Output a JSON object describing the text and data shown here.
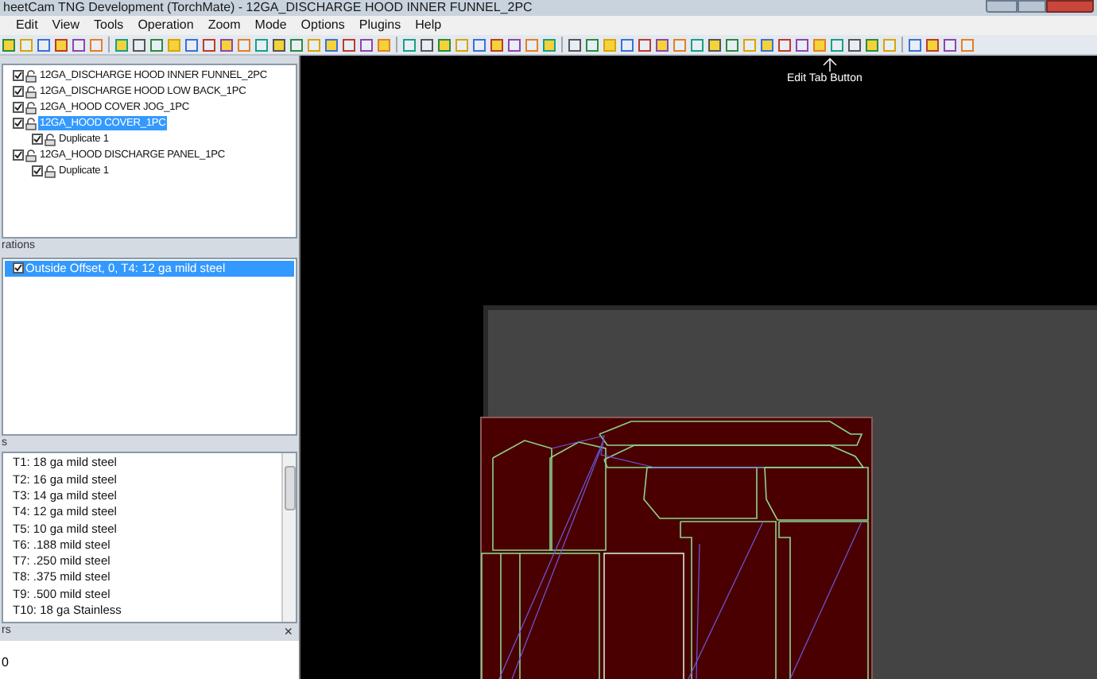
{
  "window": {
    "title": "heetCam TNG Development (TorchMate) - 12GA_DISCHARGE HOOD INNER FUNNEL_2PC"
  },
  "menu": [
    "Edit",
    "View",
    "Tools",
    "Operation",
    "Zoom",
    "Mode",
    "Options",
    "Plugins",
    "Help"
  ],
  "parts_tree": [
    {
      "label": "12GA_DISCHARGE HOOD INNER FUNNEL_2PC",
      "checked": true,
      "selected": false
    },
    {
      "label": "12GA_DISCHARGE HOOD LOW BACK_1PC",
      "checked": true,
      "selected": false
    },
    {
      "label": "12GA_HOOD COVER JOG_1PC",
      "checked": true,
      "selected": false
    },
    {
      "label": "12GA_HOOD COVER_1PC",
      "checked": true,
      "selected": true,
      "children": [
        {
          "label": "Duplicate 1",
          "checked": true,
          "selected": false
        }
      ]
    },
    {
      "label": "12GA_HOOD DISCHARGE PANEL_1PC",
      "checked": true,
      "selected": false,
      "children": [
        {
          "label": "Duplicate 1",
          "checked": true,
          "selected": false
        }
      ]
    }
  ],
  "operations_panel": {
    "title": "rations",
    "items": [
      {
        "label": "Outside Offset, 0, T4: 12 ga mild steel",
        "checked": true,
        "selected": true
      }
    ]
  },
  "tools_panel": {
    "title": "s",
    "items": [
      "T1: 18 ga mild steel",
      "T2: 16 ga mild steel",
      "T3: 14 ga mild steel",
      "T4: 12 ga mild steel",
      "T5: 10 ga mild steel",
      "T6: .188 mild steel",
      "T7: .250 mild steel",
      "T8: .375 mild steel",
      "T9: .500 mild steel",
      "T10: 18 ga Stainless"
    ]
  },
  "bottom_panel": {
    "title": "rs",
    "close": "×",
    "value": "0"
  },
  "annotation": {
    "label": "Edit Tab Button"
  }
}
